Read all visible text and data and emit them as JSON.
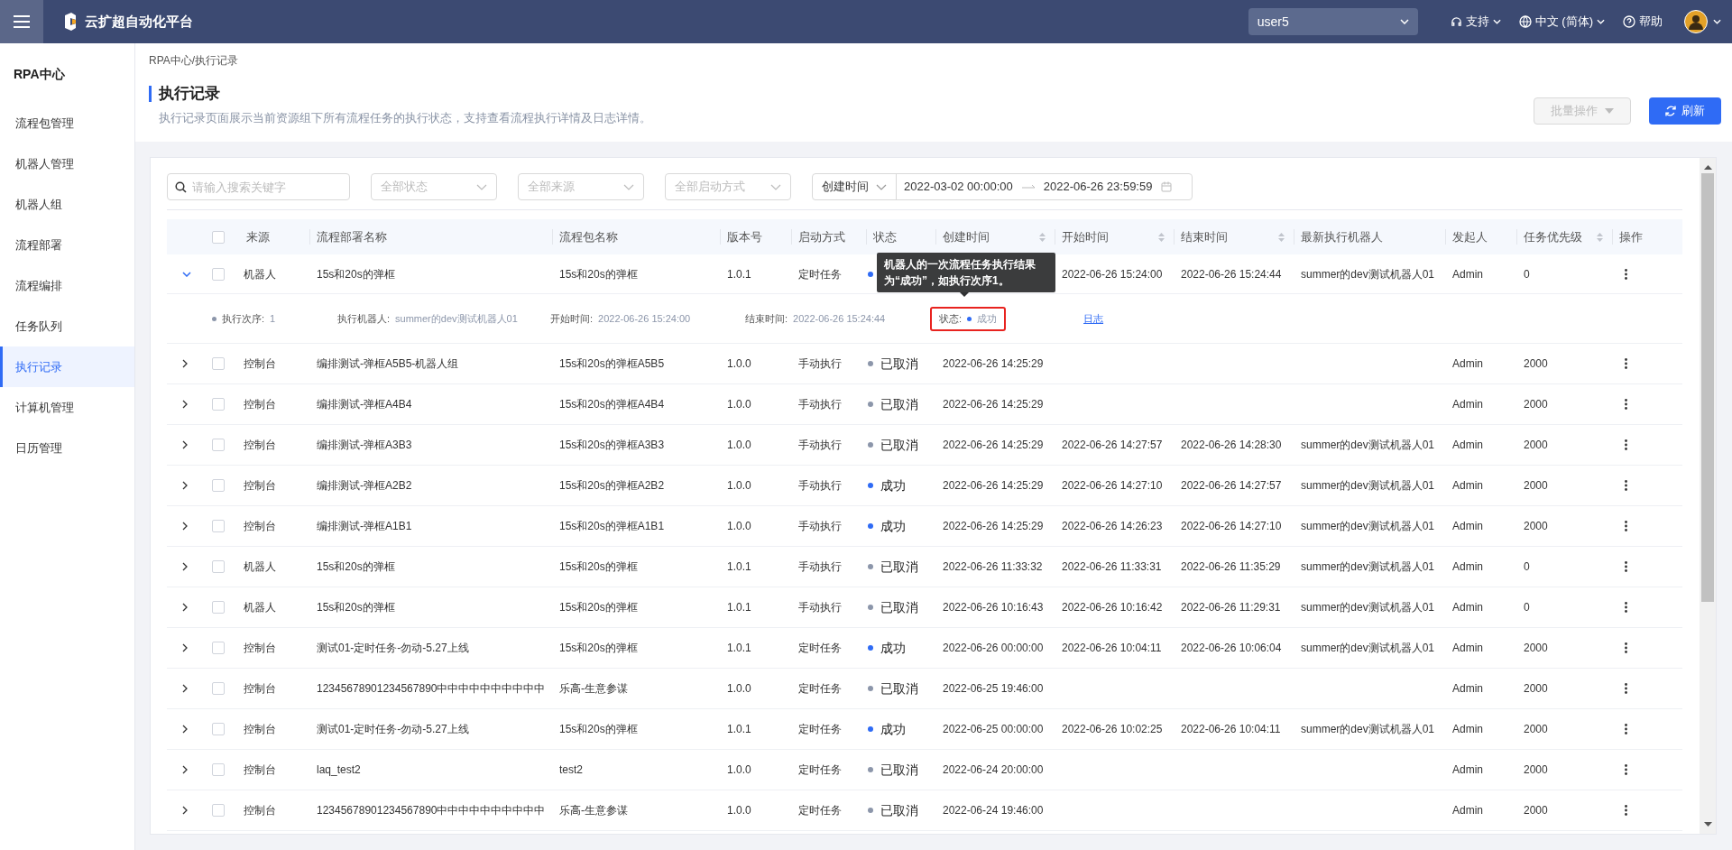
{
  "header": {
    "brand": "云扩超自动化平台",
    "user_select": "user5",
    "support": "支持",
    "language": "中文 (简体)",
    "help": "帮助"
  },
  "sidebar": {
    "title": "RPA中心",
    "items": [
      {
        "label": "流程包管理",
        "selected": false
      },
      {
        "label": "机器人管理",
        "selected": false
      },
      {
        "label": "机器人组",
        "selected": false
      },
      {
        "label": "流程部署",
        "selected": false
      },
      {
        "label": "流程编排",
        "selected": false
      },
      {
        "label": "任务队列",
        "selected": false
      },
      {
        "label": "执行记录",
        "selected": true
      },
      {
        "label": "计算机管理",
        "selected": false
      },
      {
        "label": "日历管理",
        "selected": false
      }
    ]
  },
  "breadcrumb": "RPA中心/执行记录",
  "page": {
    "title": "执行记录",
    "description": "执行记录页面展示当前资源组下所有流程任务的执行状态，支持查看流程执行详情及日志详情。",
    "buttons": [
      {
        "label": "批量操作",
        "kind": "dropdown",
        "disabled": true
      },
      {
        "label": "刷新",
        "kind": "primary",
        "disabled": false
      }
    ]
  },
  "filters": {
    "search_placeholder": "请输入搜索关键字",
    "selects": [
      "全部状态",
      "全部来源",
      "全部启动方式"
    ],
    "date_range": {
      "field": "创建时间",
      "start": "2022-03-02 00:00:00",
      "end": "2022-06-26 23:59:59"
    }
  },
  "table": {
    "select_all_checked": false,
    "columns": [
      {
        "label": "来源",
        "sortable": false
      },
      {
        "label": "流程部署名称",
        "sortable": false
      },
      {
        "label": "流程包名称",
        "sortable": false
      },
      {
        "label": "版本号",
        "sortable": false
      },
      {
        "label": "启动方式",
        "sortable": false
      },
      {
        "label": "状态",
        "sortable": false
      },
      {
        "label": "创建时间",
        "sortable": true
      },
      {
        "label": "开始时间",
        "sortable": true
      },
      {
        "label": "结束时间",
        "sortable": true
      },
      {
        "label": "最新执行机器人",
        "sortable": false
      },
      {
        "label": "发起人",
        "sortable": false
      },
      {
        "label": "任务优先级",
        "sortable": true
      },
      {
        "label": "操作",
        "sortable": false
      }
    ],
    "rows": [
      {
        "expanded": true,
        "checked": false,
        "source": "机器人",
        "deployment": "15s和20s的弹框",
        "package": "15s和20s的弹框",
        "version": "1.0.1",
        "start_mode": "定时任务",
        "status": {
          "color": "#2f6bf5"
        },
        "started": "2022-06-26 15:24:00",
        "ended": "2022-06-26 15:24:44",
        "robot": "summer的dev测试机器人01",
        "initiator": "Admin",
        "priority": "0",
        "detail": {
          "items": [
            {
              "label": "执行次序:",
              "value": "1"
            },
            {
              "label": "执行机器人:",
              "value": "summer的dev测试机器人01"
            },
            {
              "label": "开始时间:",
              "value": "2022-06-26 15:24:00"
            },
            {
              "label": "结束时间:",
              "value": "2022-06-26 15:24:44"
            }
          ],
          "status": {
            "label": "状态:",
            "value": "成功",
            "color": "#2f6bf5",
            "highlighted": true
          },
          "log_link": "日志"
        },
        "tooltip": "机器人的一次流程任务执行结果为“成功”，如执行次序1。"
      },
      {
        "expanded": false,
        "checked": false,
        "source": "控制台",
        "deployment": "编排测试-弹框A5B5-机器人组",
        "package": "15s和20s的弹框A5B5",
        "version": "1.0.0",
        "start_mode": "手动执行",
        "status": {
          "label": "已取消",
          "color": "#8c96aa"
        },
        "created": "2022-06-26 14:25:29",
        "initiator": "Admin",
        "priority": "2000"
      },
      {
        "expanded": false,
        "checked": false,
        "source": "控制台",
        "deployment": "编排测试-弹框A4B4",
        "package": "15s和20s的弹框A4B4",
        "version": "1.0.0",
        "start_mode": "手动执行",
        "status": {
          "label": "已取消",
          "color": "#8c96aa"
        },
        "created": "2022-06-26 14:25:29",
        "initiator": "Admin",
        "priority": "2000"
      },
      {
        "expanded": false,
        "checked": false,
        "source": "控制台",
        "deployment": "编排测试-弹框A3B3",
        "package": "15s和20s的弹框A3B3",
        "version": "1.0.0",
        "start_mode": "手动执行",
        "status": {
          "label": "已取消",
          "color": "#8c96aa"
        },
        "created": "2022-06-26 14:25:29",
        "started": "2022-06-26 14:27:57",
        "ended": "2022-06-26 14:28:30",
        "robot": "summer的dev测试机器人01",
        "initiator": "Admin",
        "priority": "2000"
      },
      {
        "expanded": false,
        "checked": false,
        "source": "控制台",
        "deployment": "编排测试-弹框A2B2",
        "package": "15s和20s的弹框A2B2",
        "version": "1.0.0",
        "start_mode": "手动执行",
        "status": {
          "label": "成功",
          "color": "#2f6bf5"
        },
        "created": "2022-06-26 14:25:29",
        "started": "2022-06-26 14:27:10",
        "ended": "2022-06-26 14:27:57",
        "robot": "summer的dev测试机器人01",
        "initiator": "Admin",
        "priority": "2000"
      },
      {
        "expanded": false,
        "checked": false,
        "source": "控制台",
        "deployment": "编排测试-弹框A1B1",
        "package": "15s和20s的弹框A1B1",
        "version": "1.0.0",
        "start_mode": "手动执行",
        "status": {
          "label": "成功",
          "color": "#2f6bf5"
        },
        "created": "2022-06-26 14:25:29",
        "started": "2022-06-26 14:26:23",
        "ended": "2022-06-26 14:27:10",
        "robot": "summer的dev测试机器人01",
        "initiator": "Admin",
        "priority": "2000"
      },
      {
        "expanded": false,
        "checked": false,
        "source": "机器人",
        "deployment": "15s和20s的弹框",
        "package": "15s和20s的弹框",
        "version": "1.0.1",
        "start_mode": "手动执行",
        "status": {
          "label": "已取消",
          "color": "#8c96aa"
        },
        "created": "2022-06-26 11:33:32",
        "started": "2022-06-26 11:33:31",
        "ended": "2022-06-26 11:35:29",
        "robot": "summer的dev测试机器人01",
        "initiator": "Admin",
        "priority": "0"
      },
      {
        "expanded": false,
        "checked": false,
        "source": "机器人",
        "deployment": "15s和20s的弹框",
        "package": "15s和20s的弹框",
        "version": "1.0.1",
        "start_mode": "手动执行",
        "status": {
          "label": "已取消",
          "color": "#8c96aa"
        },
        "created": "2022-06-26 10:16:43",
        "started": "2022-06-26 10:16:42",
        "ended": "2022-06-26 11:29:31",
        "robot": "summer的dev测试机器人01",
        "initiator": "Admin",
        "priority": "0"
      },
      {
        "expanded": false,
        "checked": false,
        "source": "控制台",
        "deployment": "测试01-定时任务-勿动-5.27上线",
        "package": "15s和20s的弹框",
        "version": "1.0.1",
        "start_mode": "定时任务",
        "status": {
          "label": "成功",
          "color": "#2f6bf5"
        },
        "created": "2022-06-26 00:00:00",
        "started": "2022-06-26 10:04:11",
        "ended": "2022-06-26 10:06:04",
        "robot": "summer的dev测试机器人01",
        "initiator": "Admin",
        "priority": "2000"
      },
      {
        "expanded": false,
        "checked": false,
        "source": "控制台",
        "deployment": "12345678901234567890中中中中中中中中中中",
        "package": "乐高-生意参谋",
        "version": "1.0.0",
        "start_mode": "定时任务",
        "status": {
          "label": "已取消",
          "color": "#8c96aa"
        },
        "created": "2022-06-25 19:46:00",
        "initiator": "Admin",
        "priority": "2000"
      },
      {
        "expanded": false,
        "checked": false,
        "source": "控制台",
        "deployment": "测试01-定时任务-勿动-5.27上线",
        "package": "15s和20s的弹框",
        "version": "1.0.1",
        "start_mode": "定时任务",
        "status": {
          "label": "成功",
          "color": "#2f6bf5"
        },
        "created": "2022-06-25 00:00:00",
        "started": "2022-06-26 10:02:25",
        "ended": "2022-06-26 10:04:11",
        "robot": "summer的dev测试机器人01",
        "initiator": "Admin",
        "priority": "2000"
      },
      {
        "expanded": false,
        "checked": false,
        "source": "控制台",
        "deployment": "laq_test2",
        "package": "test2",
        "version": "1.0.0",
        "start_mode": "定时任务",
        "status": {
          "label": "已取消",
          "color": "#8c96aa"
        },
        "created": "2022-06-24 20:00:00",
        "initiator": "Admin",
        "priority": "2000"
      },
      {
        "expanded": false,
        "checked": false,
        "source": "控制台",
        "deployment": "12345678901234567890中中中中中中中中中中",
        "package": "乐高-生意参谋",
        "version": "1.0.0",
        "start_mode": "定时任务",
        "status": {
          "label": "已取消",
          "color": "#8c96aa"
        },
        "created": "2022-06-24 19:46:00",
        "initiator": "Admin",
        "priority": "2000"
      }
    ]
  }
}
